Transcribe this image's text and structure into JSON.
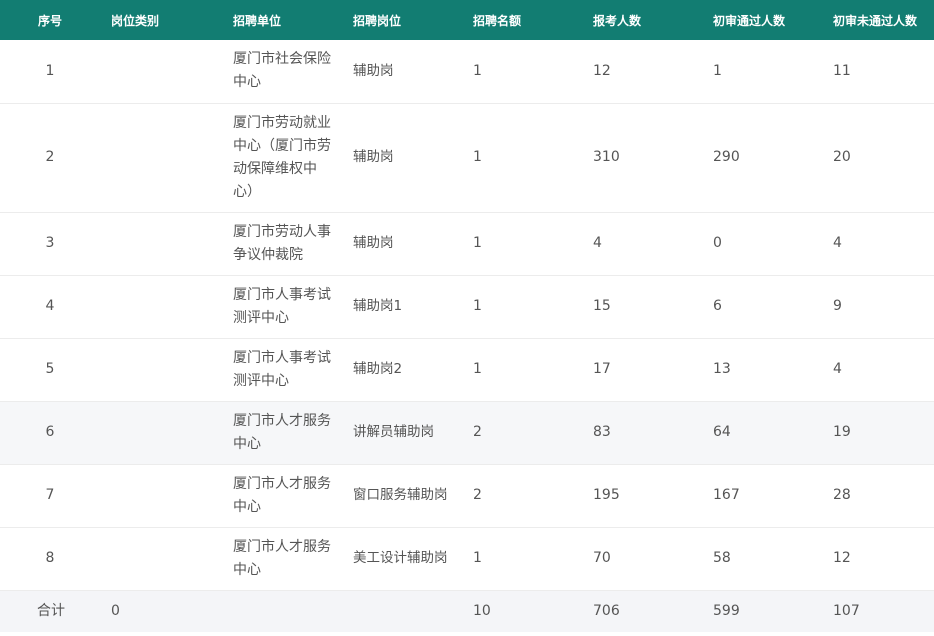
{
  "headers": [
    "序号",
    "岗位类别",
    "招聘单位",
    "招聘岗位",
    "招聘名额",
    "报考人数",
    "初审通过人数",
    "初审未通过人数"
  ],
  "rows": [
    {
      "seq": "1",
      "category": "",
      "unit": "厦门市社会保险中心",
      "post": "辅助岗",
      "quota": "1",
      "applicants": "12",
      "passed": "1",
      "failed": "11"
    },
    {
      "seq": "2",
      "category": "",
      "unit": "厦门市劳动就业中心（厦门市劳动保障维权中心）",
      "post": "辅助岗",
      "quota": "1",
      "applicants": "310",
      "passed": "290",
      "failed": "20"
    },
    {
      "seq": "3",
      "category": "",
      "unit": "厦门市劳动人事争议仲裁院",
      "post": "辅助岗",
      "quota": "1",
      "applicants": "4",
      "passed": "0",
      "failed": "4"
    },
    {
      "seq": "4",
      "category": "",
      "unit": "厦门市人事考试测评中心",
      "post": "辅助岗1",
      "quota": "1",
      "applicants": "15",
      "passed": "6",
      "failed": "9"
    },
    {
      "seq": "5",
      "category": "",
      "unit": "厦门市人事考试测评中心",
      "post": "辅助岗2",
      "quota": "1",
      "applicants": "17",
      "passed": "13",
      "failed": "4"
    },
    {
      "seq": "6",
      "category": "",
      "unit": "厦门市人才服务中心",
      "post": "讲解员辅助岗",
      "quota": "2",
      "applicants": "83",
      "passed": "64",
      "failed": "19"
    },
    {
      "seq": "7",
      "category": "",
      "unit": "厦门市人才服务中心",
      "post": "窗口服务辅助岗",
      "quota": "2",
      "applicants": "195",
      "passed": "167",
      "failed": "28"
    },
    {
      "seq": "8",
      "category": "",
      "unit": "厦门市人才服务中心",
      "post": "美工设计辅助岗",
      "quota": "1",
      "applicants": "70",
      "passed": "58",
      "failed": "12"
    }
  ],
  "total": {
    "label": "合计",
    "category": "0",
    "unit": "",
    "post": "",
    "quota": "10",
    "applicants": "706",
    "passed": "599",
    "failed": "107"
  },
  "colors": {
    "header_bg": "#127d72",
    "header_text": "#ffffff",
    "text": "#555555",
    "alt_row_bg": "#f6f7f9"
  }
}
